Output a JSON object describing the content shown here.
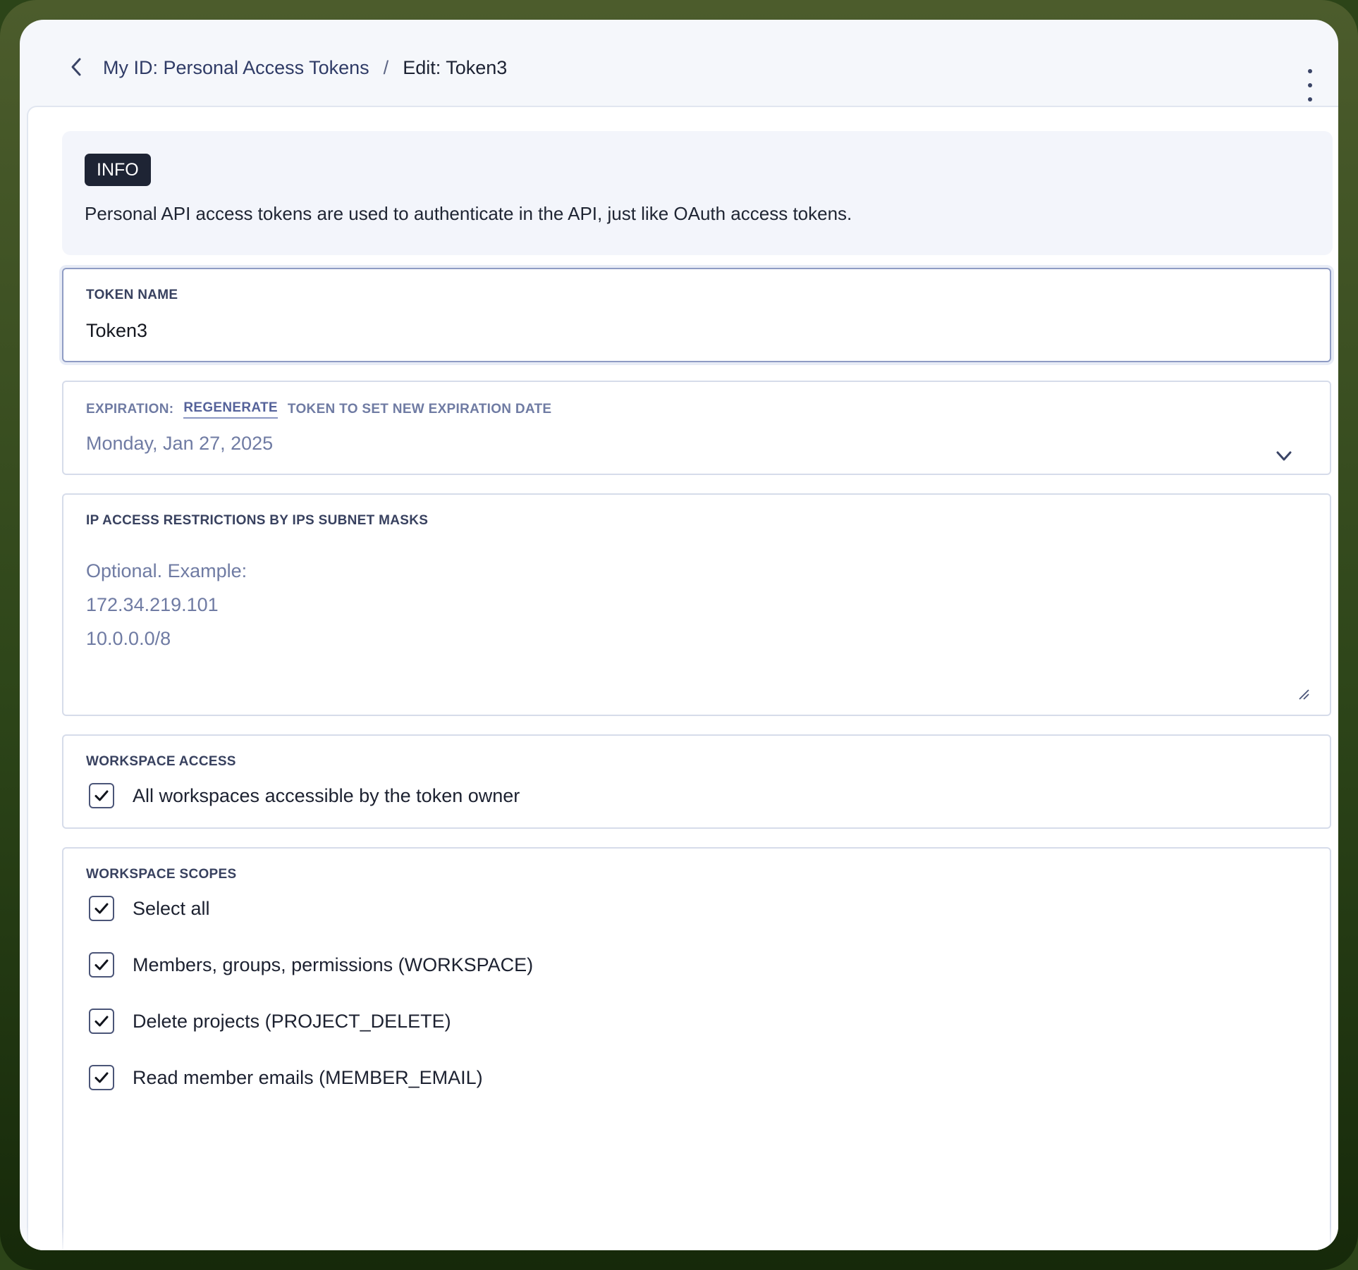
{
  "header": {
    "breadcrumb_parent": "My ID: Personal Access Tokens",
    "breadcrumb_separator": "/",
    "breadcrumb_current": "Edit: Token3",
    "back_icon": "chevron-left-icon",
    "menu_icon": "more-vertical-icon"
  },
  "info": {
    "badge": "INFO",
    "text": "Personal API access tokens are used to authenticate in the API, just like OAuth access tokens."
  },
  "token_name": {
    "label": "TOKEN NAME",
    "value": "Token3"
  },
  "expiration": {
    "label_prefix": "EXPIRATION:",
    "label_link": "REGENERATE",
    "label_suffix": "TOKEN TO SET NEW EXPIRATION DATE",
    "value": "Monday, Jan 27, 2025",
    "dropdown_icon": "chevron-down-icon"
  },
  "ip_restrictions": {
    "label": "IP ACCESS RESTRICTIONS BY IPS SUBNET MASKS",
    "placeholder_lines": [
      "Optional. Example:",
      "172.34.219.101",
      "10.0.0.0/8"
    ]
  },
  "workspace_access": {
    "label": "WORKSPACE ACCESS",
    "options": [
      {
        "label": "All workspaces accessible by the token owner",
        "checked": true
      }
    ]
  },
  "workspace_scopes": {
    "label": "WORKSPACE SCOPES",
    "options": [
      {
        "label": "Select all",
        "checked": true
      },
      {
        "label": "Members, groups, permissions (WORKSPACE)",
        "checked": true
      },
      {
        "label": "Delete projects (PROJECT_DELETE)",
        "checked": true
      },
      {
        "label": "Read member emails (MEMBER_EMAIL)",
        "checked": true
      }
    ]
  },
  "colors": {
    "frame_top": "#4c5c2c",
    "frame_bottom": "#16290a",
    "window_bg": "#f5f7fb",
    "badge_bg": "#1e2434",
    "muted_text": "#6f7ba3",
    "focus_border": "#8f9cc4"
  }
}
